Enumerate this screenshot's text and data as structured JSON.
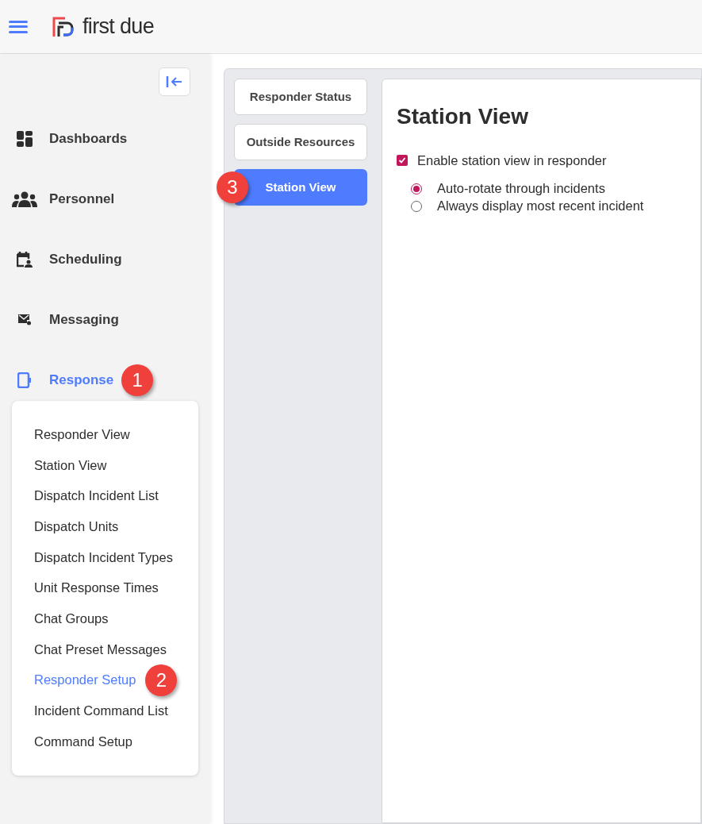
{
  "header": {
    "logo_text": "first due"
  },
  "sidebar": {
    "items": [
      {
        "kind": "dashboards",
        "label": "Dashboards",
        "selected": false
      },
      {
        "kind": "personnel",
        "label": "Personnel",
        "selected": false
      },
      {
        "kind": "scheduling",
        "label": "Scheduling",
        "selected": false
      },
      {
        "kind": "messaging",
        "label": "Messaging",
        "selected": false
      },
      {
        "kind": "response",
        "label": "Response",
        "selected": true,
        "callout": "1",
        "expanded": true,
        "children": [
          {
            "label": "Responder View",
            "selected": false
          },
          {
            "label": "Station View",
            "selected": false
          },
          {
            "label": "Dispatch Incident List",
            "selected": false
          },
          {
            "label": "Dispatch Units",
            "selected": false
          },
          {
            "label": "Dispatch Incident Types",
            "selected": false
          },
          {
            "label": "Unit Response Times",
            "selected": false
          },
          {
            "label": "Chat Groups",
            "selected": false
          },
          {
            "label": "Chat Preset Messages",
            "selected": false
          },
          {
            "label": "Responder Setup",
            "selected": true,
            "callout": "2"
          },
          {
            "label": "Incident Command List",
            "selected": false
          },
          {
            "label": "Command Setup",
            "selected": false
          }
        ]
      }
    ]
  },
  "tabs": [
    {
      "label": "Responder Status",
      "selected": false
    },
    {
      "label": "Outside Resources",
      "selected": false
    },
    {
      "label": "Station View",
      "selected": true,
      "callout": "3"
    }
  ],
  "panel": {
    "title": "Station View",
    "checkbox": {
      "label": "Enable station view in responder",
      "checked": true
    },
    "radios": [
      {
        "label": "Auto-rotate through incidents",
        "selected": true
      },
      {
        "label": "Always display most recent incident",
        "selected": false
      }
    ]
  }
}
